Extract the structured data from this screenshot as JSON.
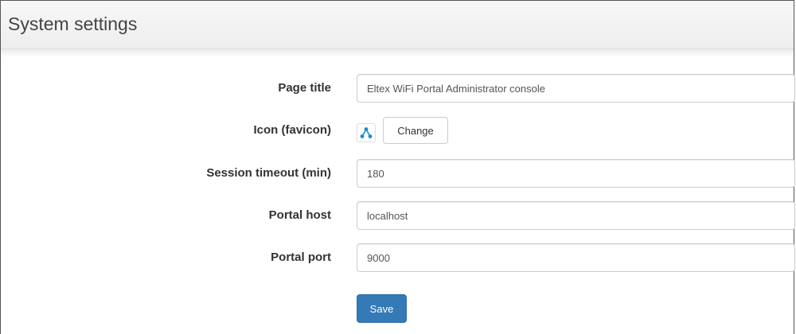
{
  "header": {
    "title": "System settings"
  },
  "form": {
    "page_title": {
      "label": "Page title",
      "value": "Eltex WiFi Portal Administrator console"
    },
    "favicon": {
      "label": "Icon (favicon)",
      "icon": "eltex-logo-icon",
      "change_label": "Change"
    },
    "session_timeout": {
      "label": "Session timeout (min)",
      "value": "180"
    },
    "portal_host": {
      "label": "Portal host",
      "value": "localhost"
    },
    "portal_port": {
      "label": "Portal port",
      "value": "9000"
    },
    "save_label": "Save"
  },
  "colors": {
    "primary": "#337ab7",
    "favicon": "#1a8fc9"
  }
}
